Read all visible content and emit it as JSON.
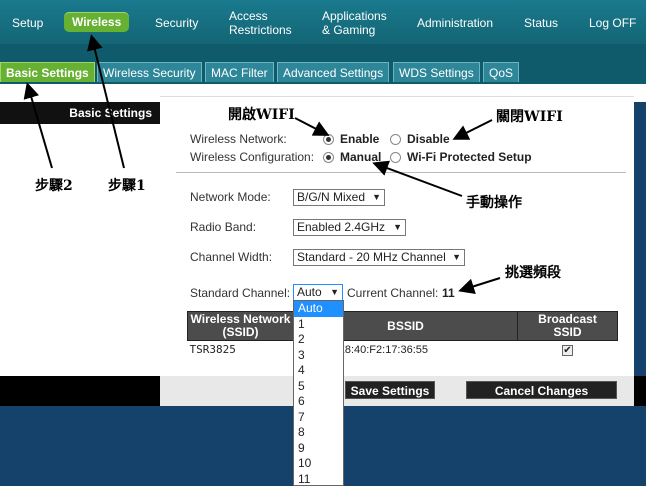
{
  "nav": {
    "items": [
      "Setup",
      "Wireless",
      "Security",
      "Access\nRestrictions",
      "Applications\n& Gaming",
      "Administration",
      "Status",
      "Log OFF"
    ],
    "active": "Wireless"
  },
  "subnav": {
    "tabs": [
      "Basic Settings",
      "Wireless Security",
      "MAC Filter",
      "Advanced Settings",
      "WDS Settings",
      "QoS"
    ]
  },
  "section_title": "Basic Settings",
  "form": {
    "wireless_network": {
      "label": "Wireless Network:",
      "enable": "Enable",
      "disable": "Disable"
    },
    "wireless_config": {
      "label": "Wireless Configuration:",
      "manual": "Manual",
      "wps": "Wi-Fi Protected Setup"
    },
    "network_mode": {
      "label": "Network Mode:",
      "value": "B/G/N Mixed"
    },
    "radio_band": {
      "label": "Radio Band:",
      "value": "Enabled 2.4GHz"
    },
    "channel_width": {
      "label": "Channel Width:",
      "value": "Standard - 20 MHz Channel"
    },
    "standard_channel": {
      "label": "Standard Channel:",
      "value": "Auto"
    },
    "current_channel": {
      "label": "Current Channel:",
      "value": "11"
    }
  },
  "table": {
    "headers": [
      "Wireless Network\n(SSID)",
      "BSSID",
      "Broadcast\nSSID"
    ],
    "row": {
      "ssid": "TSR3825",
      "bssid": "E8:40:F2:17:36:55"
    }
  },
  "buttons": {
    "save": "Save Settings",
    "cancel": "Cancel Changes"
  },
  "dropdown_options": [
    "Auto",
    "1",
    "2",
    "3",
    "4",
    "5",
    "6",
    "7",
    "8",
    "9",
    "10",
    "11"
  ],
  "annotations": {
    "open_wifi": "開啟WIFI",
    "close_wifi": "關閉WIFI",
    "manual_op": "手動操作",
    "pick_channel": "挑選頻段",
    "step1": "步驟1",
    "step2": "步驟2"
  }
}
